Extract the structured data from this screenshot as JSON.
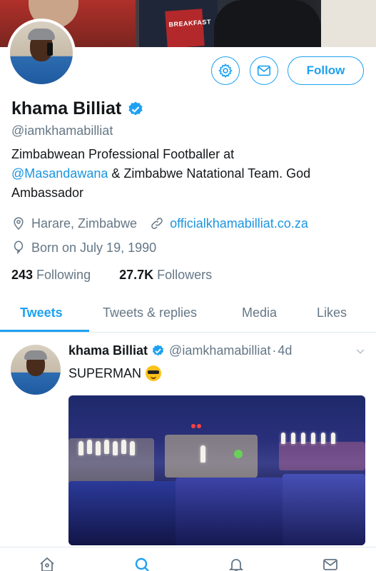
{
  "profile": {
    "name": "khama Billiat",
    "handle": "@iamkhamabilliat",
    "bio_line1": "Zimbabwean Professional Footballer at",
    "bio_mention": "@Masandawana",
    "bio_rest": " & Zimbabwe Natational Team. God",
    "bio_line3": "Ambassador",
    "location": "Harare, Zimbabwe",
    "website": "officialkhamabilliat.co.za",
    "birth": "Born on July 19, 1990",
    "following_count": "243",
    "following_label": "Following",
    "followers_count": "27.7K",
    "followers_label": "Followers"
  },
  "banner": {
    "book_text": "BREAKFAST"
  },
  "actions": {
    "follow_label": "Follow",
    "settings_icon": "gear-icon",
    "message_icon": "envelope-icon"
  },
  "tabs": [
    {
      "label": "Tweets",
      "active": true
    },
    {
      "label": "Tweets & replies",
      "active": false
    },
    {
      "label": "Media",
      "active": false
    },
    {
      "label": "Likes",
      "active": false
    }
  ],
  "tweet": {
    "name": "khama Billiat",
    "handle": "@iamkhamabilliat",
    "dot": "·",
    "time": "4d",
    "text": "SUPERMAN",
    "emoji": "smiling-face-with-sunglasses"
  },
  "colors": {
    "accent": "#1da1f2",
    "link": "#1b95e0",
    "muted": "#657786",
    "text": "#14171a"
  },
  "bottom_nav": [
    "home-icon",
    "search-icon",
    "notifications-icon",
    "messages-icon"
  ]
}
